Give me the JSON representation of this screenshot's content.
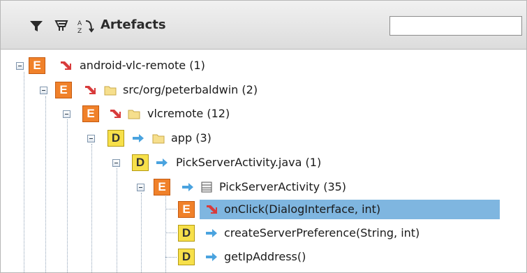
{
  "toolbar": {
    "title": "Artefacts",
    "icons": [
      "filter-icon",
      "filter-cart-icon",
      "sort-icon"
    ],
    "search_value": ""
  },
  "tree": {
    "nodes": [
      {
        "badge": "E",
        "icon": "red-arrow-icon",
        "kind": "none",
        "label": "android-vlc-remote (1)"
      },
      {
        "badge": "E",
        "icon": "red-arrow-icon",
        "kind": "folder",
        "label": "src/org/peterbaldwin (2)"
      },
      {
        "badge": "E",
        "icon": "red-arrow-icon",
        "kind": "folder",
        "label": "vlcremote (12)"
      },
      {
        "badge": "D",
        "icon": "blue-arrow-icon",
        "kind": "folder",
        "label": "app (3)"
      },
      {
        "badge": "D",
        "icon": "blue-arrow-icon",
        "kind": "none",
        "label": "PickServerActivity.java (1)"
      },
      {
        "badge": "E",
        "icon": "blue-arrow-icon",
        "kind": "class",
        "label": "PickServerActivity (35)"
      },
      {
        "badge": "E",
        "icon": "red-arrow-icon",
        "kind": "none",
        "label": "onClick(DialogInterface, int)",
        "selected": true
      },
      {
        "badge": "D",
        "icon": "blue-arrow-icon",
        "kind": "none",
        "label": "createServerPreference(String, int)"
      },
      {
        "badge": "D",
        "icon": "blue-arrow-icon",
        "kind": "none",
        "label": "getIpAddress()"
      }
    ]
  },
  "colors": {
    "badge_E": "#f0812a",
    "badge_D": "#f7e04a",
    "selection": "#7fb6e0",
    "red_arrow": "#d83b3b",
    "blue_arrow": "#4aa3df"
  }
}
